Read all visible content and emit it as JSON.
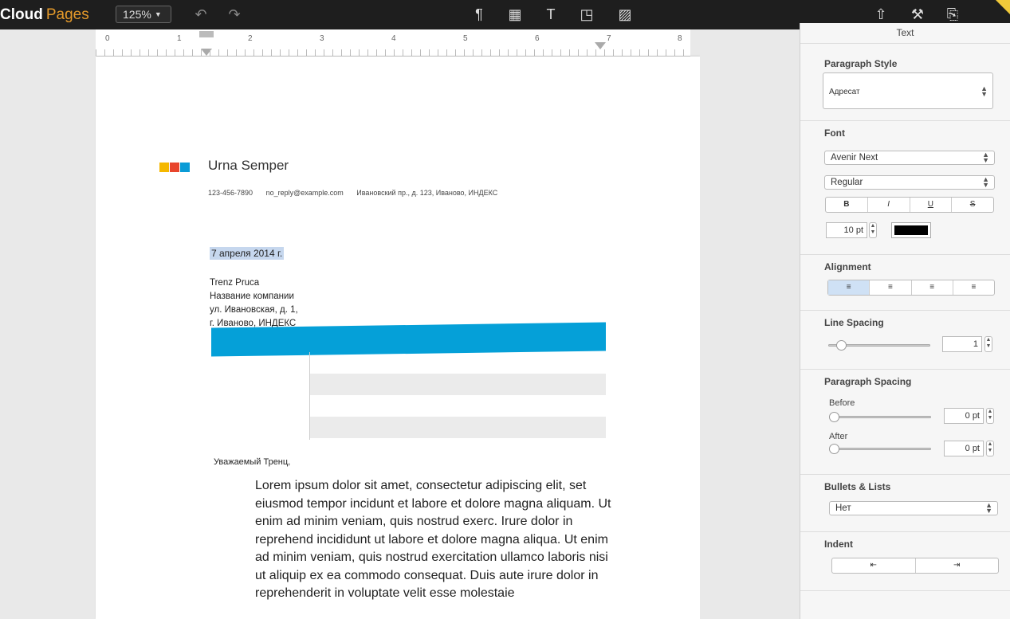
{
  "app": {
    "brand_cloud": "Cloud",
    "brand_pages": "Pages",
    "zoom": "125%"
  },
  "ruler": {
    "marks": [
      "0",
      "1",
      "2",
      "3",
      "4",
      "5",
      "6",
      "7",
      "8"
    ]
  },
  "document": {
    "sender_name": "Urna Semper",
    "phone": "123-456-7890",
    "email": "no_reply@example.com",
    "address": "Ивановский пр., д. 123,  Иваново, ИНДЕКС",
    "date": "7 апреля 2014 г.",
    "recipient": [
      "Trenz Pruca",
      "Название компании",
      "ул. Ивановская, д. 1,",
      "г. Иваново, ИНДЕКС"
    ],
    "salutation": "Уважаемый Тренц,",
    "body": "Lorem ipsum dolor sit amet, consectetur adipiscing elit, set eiusmod tempor incidunt et labore et dolore magna aliquam. Ut enim ad minim veniam, quis nostrud exerc. Irure dolor in reprehend incididunt ut labore et dolore magna aliqua. Ut enim ad minim veniam, quis nostrud exercitation ullamco laboris nisi ut aliquip ex ea commodo consequat. Duis aute irure dolor in reprehenderit in voluptate velit esse molestaie"
  },
  "sidebar": {
    "title": "Text",
    "paragraph_style": {
      "label": "Paragraph Style",
      "value": "Адресат"
    },
    "font": {
      "label": "Font",
      "family": "Avenir Next",
      "style": "Regular",
      "size": "10 pt",
      "color": "#000000",
      "bold": "B",
      "italic": "I",
      "underline": "U",
      "strike": "S"
    },
    "alignment": {
      "label": "Alignment"
    },
    "line_spacing": {
      "label": "Line Spacing",
      "value": "1"
    },
    "paragraph_spacing": {
      "label": "Paragraph Spacing",
      "before_label": "Before",
      "before": "0 pt",
      "after_label": "After",
      "after": "0 pt"
    },
    "bullets": {
      "label": "Bullets & Lists",
      "value": "Нет"
    },
    "indent": {
      "label": "Indent"
    }
  }
}
